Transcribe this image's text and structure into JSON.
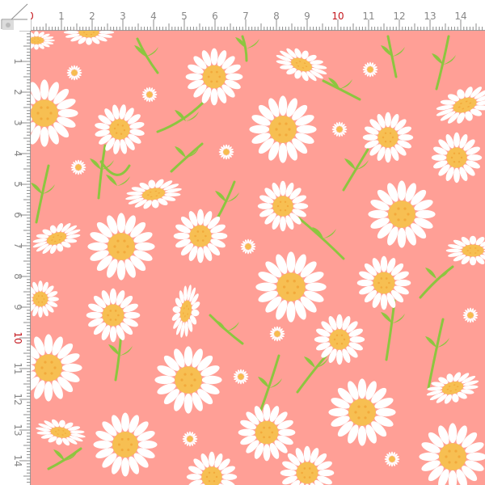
{
  "ruler": {
    "top_labels": [
      "0",
      "1",
      "2",
      "3",
      "4",
      "5",
      "6",
      "7",
      "8",
      "9",
      "10",
      "11",
      "12",
      "13",
      "14"
    ],
    "left_labels": [
      "1",
      "2",
      "3",
      "4",
      "5",
      "6",
      "7",
      "8",
      "9",
      "10",
      "11",
      "12",
      "13",
      "14"
    ],
    "accent_label": "10",
    "label_color": "#888888",
    "accent_color": "#c4161c"
  },
  "pattern": {
    "background_color": "#ff9f96",
    "petal_color": "#ffffff",
    "center_color": "#f7bf52",
    "stem_color": "#8cc63f",
    "motif": "daisy"
  }
}
